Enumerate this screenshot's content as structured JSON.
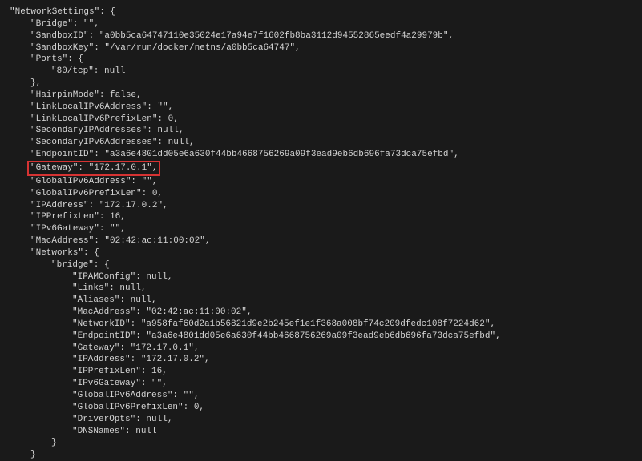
{
  "json": {
    "header": "\"NetworkSettings\": {",
    "bridge": "\"Bridge\": \"\",",
    "sandboxId": "\"SandboxID\": \"a0bb5ca64747110e35024e17a94e7f1602fb8ba3112d94552865eedf4a29979b\",",
    "sandboxKey": "\"SandboxKey\": \"/var/run/docker/netns/a0bb5ca64747\",",
    "portsOpen": "\"Ports\": {",
    "port80": "\"80/tcp\": null",
    "portsClose": "},",
    "hairpinMode": "\"HairpinMode\": false,",
    "linkLocalIPv6Address": "\"LinkLocalIPv6Address\": \"\",",
    "linkLocalIPv6PrefixLen": "\"LinkLocalIPv6PrefixLen\": 0,",
    "secondaryIPAddresses": "\"SecondaryIPAddresses\": null,",
    "secondaryIPv6Addresses": "\"SecondaryIPv6Addresses\": null,",
    "endpointId": "\"EndpointID\": \"a3a6e4801dd05e6a630f44bb4668756269a09f3ead9eb6db696fa73dca75efbd\",",
    "gateway": "\"Gateway\": \"172.17.0.1\",",
    "globalIPv6Address": "\"GlobalIPv6Address\": \"\",",
    "globalIPv6PrefixLen": "\"GlobalIPv6PrefixLen\": 0,",
    "ipAddress": "\"IPAddress\": \"172.17.0.2\",",
    "ipPrefixLen": "\"IPPrefixLen\": 16,",
    "ipv6Gateway": "\"IPv6Gateway\": \"\",",
    "macAddress": "\"MacAddress\": \"02:42:ac:11:00:02\",",
    "networksOpen": "\"Networks\": {",
    "bridgeNetOpen": "\"bridge\": {",
    "ipamConfig": "\"IPAMConfig\": null,",
    "links": "\"Links\": null,",
    "aliases": "\"Aliases\": null,",
    "netMacAddress": "\"MacAddress\": \"02:42:ac:11:00:02\",",
    "networkId": "\"NetworkID\": \"a958faf60d2a1b56821d9e2b245ef1e1f368a008bf74c209dfedc108f7224d62\",",
    "netEndpointId": "\"EndpointID\": \"a3a6e4801dd05e6a630f44bb4668756269a09f3ead9eb6db696fa73dca75efbd\",",
    "netGateway": "\"Gateway\": \"172.17.0.1\",",
    "netIpAddress": "\"IPAddress\": \"172.17.0.2\",",
    "netIpPrefixLen": "\"IPPrefixLen\": 16,",
    "netIpv6Gateway": "\"IPv6Gateway\": \"\",",
    "netGlobalIPv6Address": "\"GlobalIPv6Address\": \"\",",
    "netGlobalIPv6PrefixLen": "\"GlobalIPv6PrefixLen\": 0,",
    "driverOpts": "\"DriverOpts\": null,",
    "dnsNames": "\"DNSNames\": null",
    "bridgeNetClose": "}",
    "networksClose": "}"
  }
}
